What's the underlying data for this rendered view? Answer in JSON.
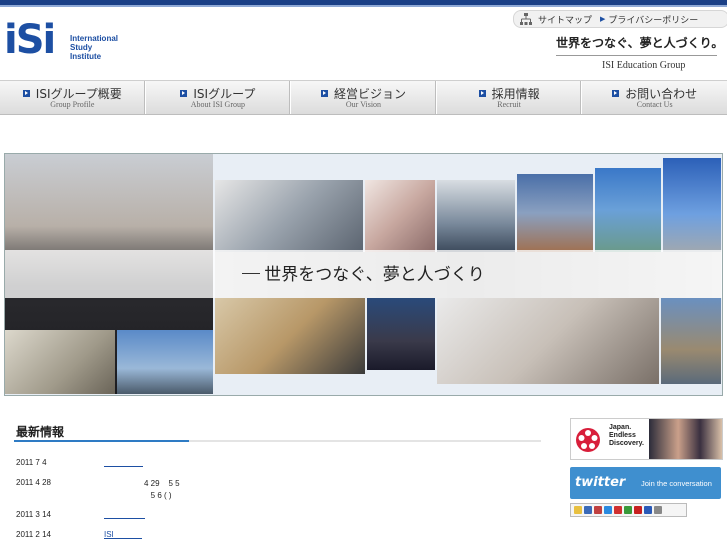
{
  "header": {
    "logo_mark": "iSi",
    "logo_lines": [
      "International",
      "Study",
      "Institute"
    ],
    "top_links": [
      {
        "label": "サイトマップ",
        "icon": "sitemap-icon"
      },
      {
        "label": "プライバシーポリシー",
        "icon": "triangle-right-icon"
      }
    ],
    "tagline": "世界をつなぐ、夢と人づくり。",
    "group_name": "ISI Education Group"
  },
  "nav": {
    "items": [
      {
        "jp": "ISIグループ概要",
        "en": "Group Profile"
      },
      {
        "jp": "ISIグループ",
        "en": "About ISI Group"
      },
      {
        "jp": "経営ビジョン",
        "en": "Our Vision"
      },
      {
        "jp": "採用情報",
        "en": "Recruit"
      },
      {
        "jp": "お問い合わせ",
        "en": "Contact Us"
      }
    ]
  },
  "hero": {
    "caption": "世界をつなぐ、夢と人づくり"
  },
  "news": {
    "title": "最新情報",
    "rows": [
      {
        "date": "2011 7 4",
        "link": "",
        "text": ""
      },
      {
        "date": "2011 4 28",
        "link": "",
        "text": "4 29    5 5\n   5 6 ( )"
      },
      {
        "date": "2011 3 14",
        "link": "",
        "text": ""
      },
      {
        "date": "2011 2 14",
        "link": "ISI",
        "text": ""
      }
    ]
  },
  "sidebar": {
    "japan_banner_lines": [
      "Japan.",
      "Endless",
      "Discovery."
    ],
    "twitter_logo": "twitter",
    "twitter_text": "Join the conversation"
  },
  "colors": {
    "brand": "#1d4fa3",
    "accent": "#2e7bc4",
    "twitter": "#3f8fcf"
  }
}
